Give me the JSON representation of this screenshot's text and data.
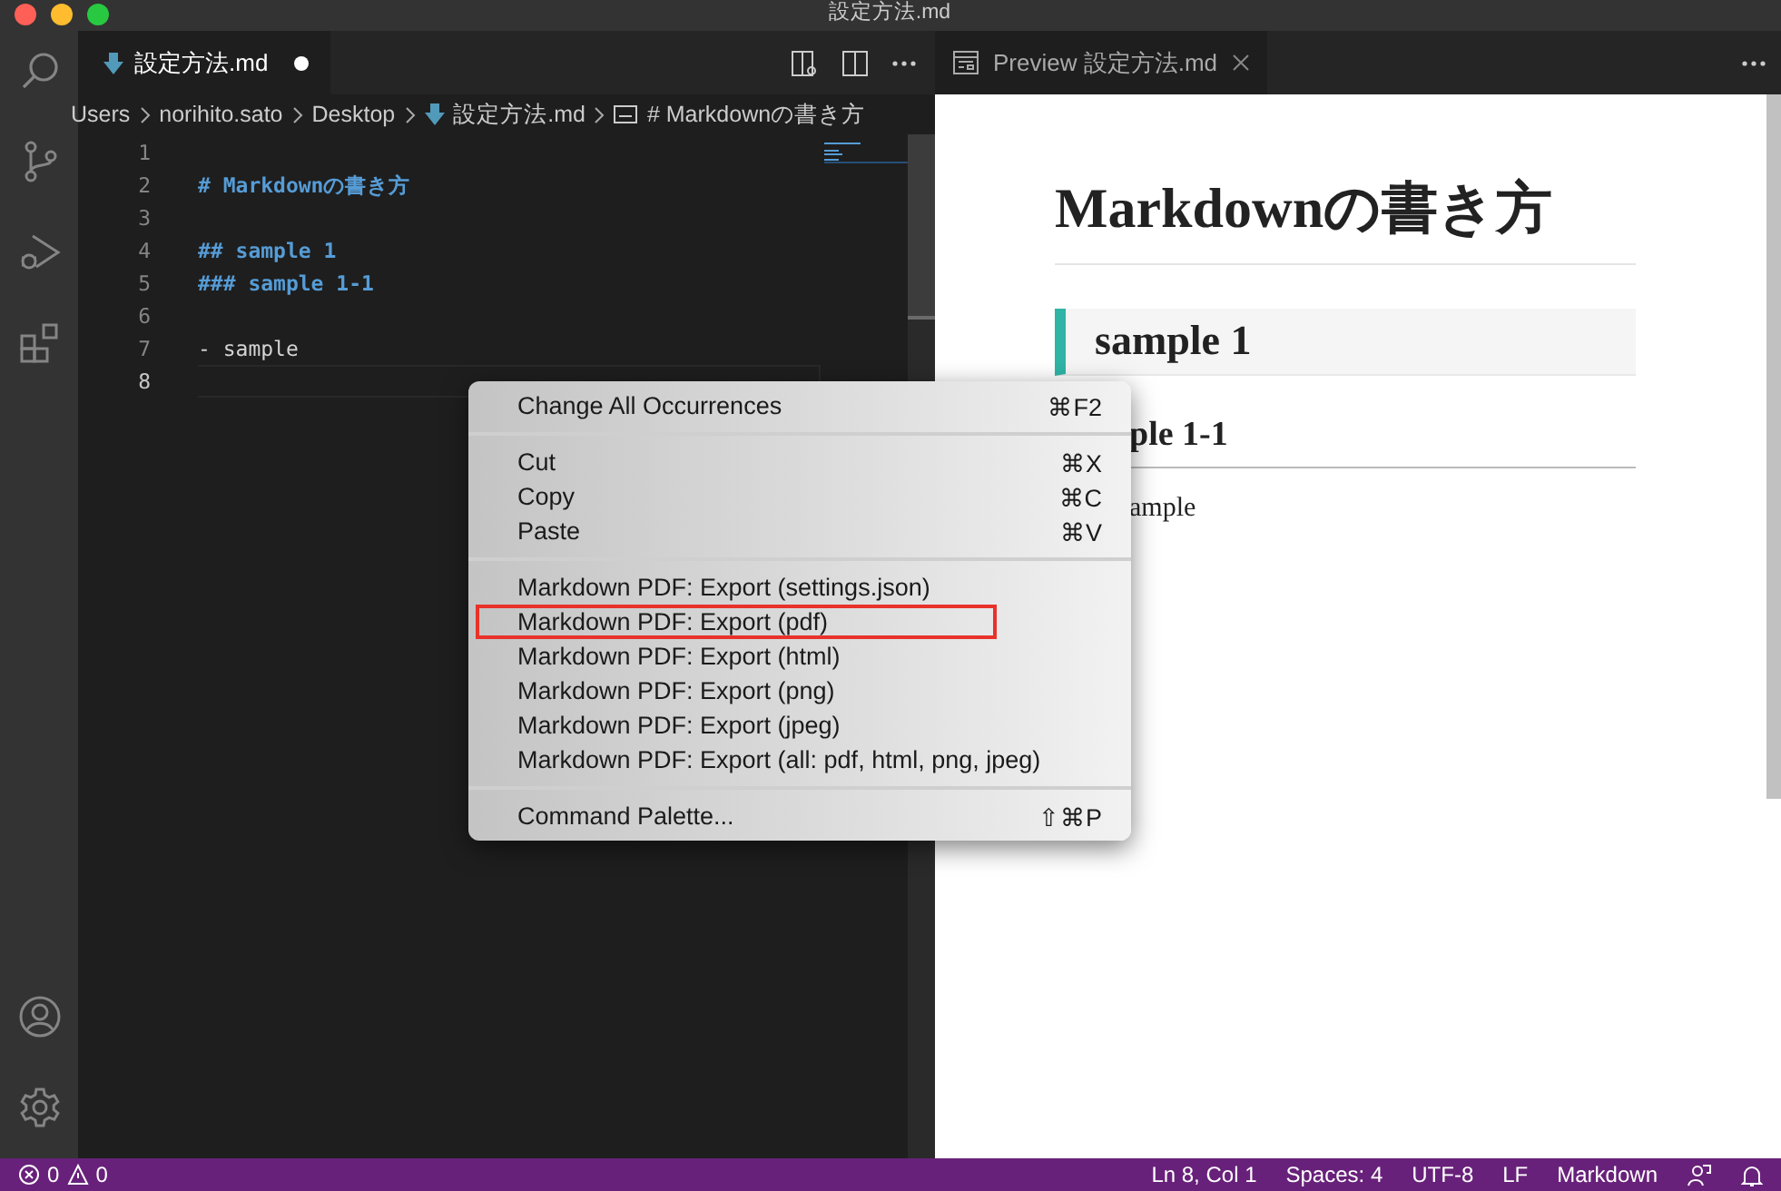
{
  "window": {
    "title": "設定方法.md"
  },
  "activity_bar": {
    "top": [
      {
        "kind": "search",
        "selected": false
      },
      {
        "kind": "source",
        "selected": false
      },
      {
        "kind": "debug",
        "selected": false
      },
      {
        "kind": "extensions",
        "selected": false
      }
    ],
    "bottom": [
      {
        "kind": "account"
      },
      {
        "kind": "settings"
      }
    ]
  },
  "editor": {
    "tab": {
      "label": "設定方法.md",
      "modified": true,
      "selected": true
    },
    "breadcrumbs": [
      {
        "label": "Users",
        "kind": "folder"
      },
      {
        "label": "norihito.sato",
        "kind": "folder"
      },
      {
        "label": "Desktop",
        "kind": "folder"
      },
      {
        "label": "設定方法.md",
        "kind": "file"
      },
      {
        "label": "# Markdownの書き方",
        "kind": "symbol"
      }
    ],
    "lines": [
      {
        "number": "1",
        "current": false
      },
      {
        "number": "2",
        "text": "# Markdownの書き方",
        "kind": "heading",
        "current": false
      },
      {
        "number": "3",
        "current": false
      },
      {
        "number": "4",
        "text": "## sample 1",
        "kind": "heading",
        "current": false
      },
      {
        "number": "5",
        "text": "### sample 1-1",
        "kind": "heading",
        "current": false
      },
      {
        "number": "6",
        "current": false
      },
      {
        "number": "7",
        "text": "- sample",
        "kind": "list",
        "current": false
      },
      {
        "number": "8",
        "current": true
      }
    ]
  },
  "preview": {
    "tab": {
      "label": "Preview 設定方法.md",
      "selected": true
    },
    "blocks": [
      {
        "kind": "h1",
        "text": "Markdownの書き方"
      },
      {
        "kind": "h2",
        "text": "sample 1"
      },
      {
        "kind": "h3",
        "text": "ple 1-1"
      },
      {
        "kind": "li",
        "text": "ample"
      }
    ]
  },
  "context_menu": {
    "groups": [
      [
        {
          "label": "Change All Occurrences",
          "shortcut": "⌘F2",
          "highlighted": false
        }
      ],
      [
        {
          "label": "Cut",
          "shortcut": "⌘X",
          "highlighted": false
        },
        {
          "label": "Copy",
          "shortcut": "⌘C",
          "highlighted": false
        },
        {
          "label": "Paste",
          "shortcut": "⌘V",
          "highlighted": false
        }
      ],
      [
        {
          "label": "Markdown PDF: Export (settings.json)",
          "highlighted": false
        },
        {
          "label": "Markdown PDF: Export (pdf)",
          "highlighted": true
        },
        {
          "label": "Markdown PDF: Export (html)",
          "highlighted": false
        },
        {
          "label": "Markdown PDF: Export (png)",
          "highlighted": false
        },
        {
          "label": "Markdown PDF: Export (jpeg)",
          "highlighted": false
        },
        {
          "label": "Markdown PDF: Export (all: pdf, html, png, jpeg)",
          "highlighted": false
        }
      ],
      [
        {
          "label": "Command Palette...",
          "shortcut": "⇧⌘P",
          "highlighted": false
        }
      ]
    ]
  },
  "status_bar": {
    "errors": "0",
    "warnings": "0",
    "items": [
      "Ln 8, Col 1",
      "Spaces: 4",
      "UTF-8",
      "LF",
      "Markdown"
    ]
  }
}
